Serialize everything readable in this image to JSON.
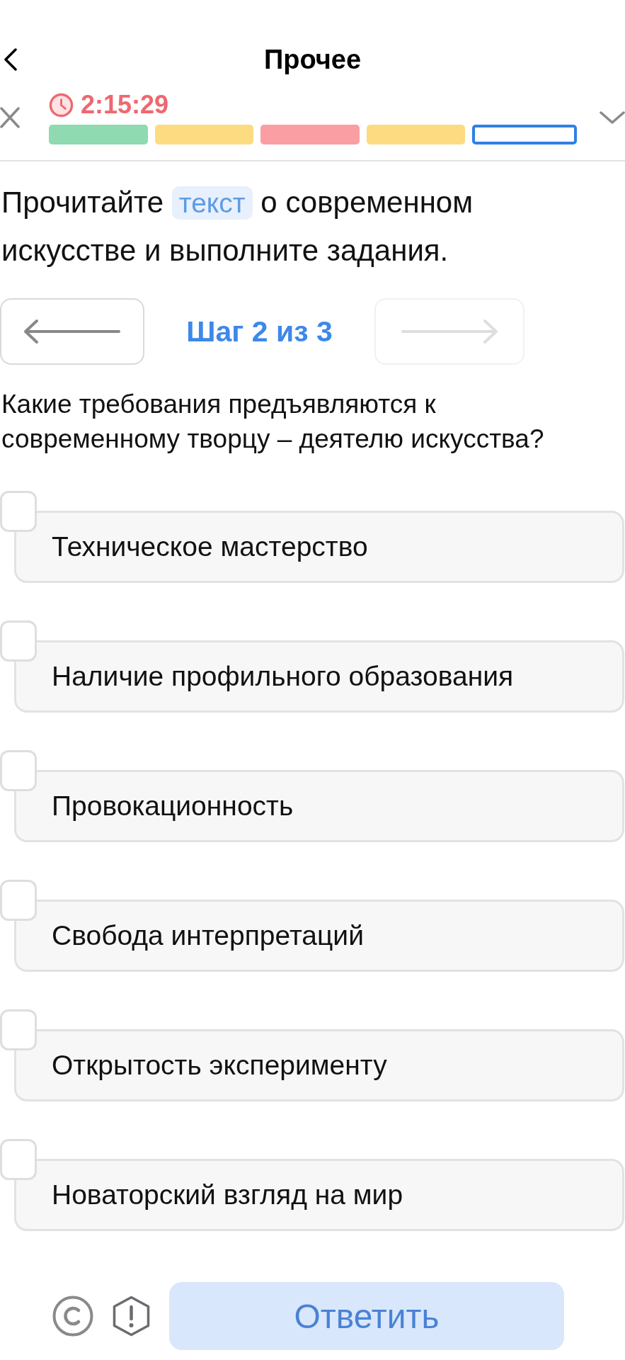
{
  "header": {
    "title": "Прочее"
  },
  "status": {
    "timer": "2:15:29",
    "progress": [
      {
        "color": "#8fdab0",
        "selected": false
      },
      {
        "color": "#fddb80",
        "selected": false
      },
      {
        "color": "#fb9ea3",
        "selected": false
      },
      {
        "color": "#fddb80",
        "selected": false
      },
      {
        "color": "#2f80e6",
        "selected": true
      }
    ]
  },
  "instruction": {
    "before": "Прочитайте",
    "link": "текст",
    "after": "о современном искусстве и выполните задания."
  },
  "step_nav": {
    "label": "Шаг 2 из 3",
    "prev": {
      "disabled": false
    },
    "next": {
      "disabled": true
    }
  },
  "question": "Какие требования предъявляются к современному творцу – деятелю искусства?",
  "options": [
    {
      "label": "Техническое мастерство",
      "checked": false
    },
    {
      "label": "Наличие профильного образования",
      "checked": false
    },
    {
      "label": "Провокационность",
      "checked": false
    },
    {
      "label": "Свобода интерпретаций",
      "checked": false
    },
    {
      "label": "Открытость эксперименту",
      "checked": false
    },
    {
      "label": "Новаторский взгляд на мир",
      "checked": false
    }
  ],
  "footer": {
    "submit": {
      "label": "Ответить",
      "disabled": true
    }
  }
}
